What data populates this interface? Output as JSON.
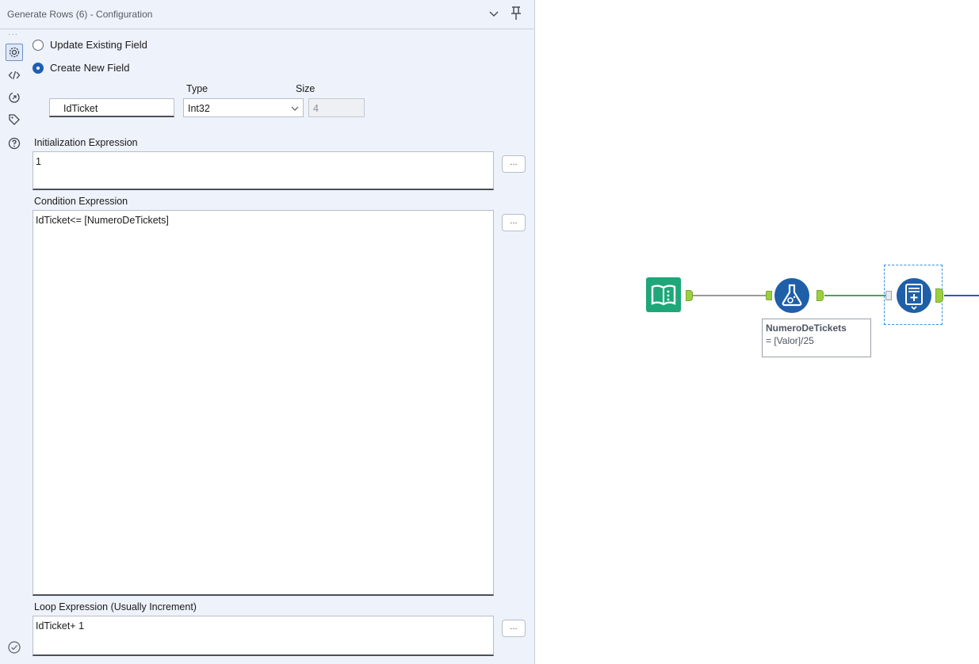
{
  "panel": {
    "title": "Generate Rows (6) - Configuration",
    "header_icons": [
      "chevron-down-icon",
      "pin-icon"
    ],
    "rail_icons": [
      "gear-icon",
      "code-icon",
      "annotation-icon",
      "tag-icon",
      "help-icon"
    ],
    "update_existing_label": "Update Existing Field",
    "create_new_label": "Create New  Field",
    "selected_mode": "create_new",
    "type_header": "Type",
    "size_header": "Size",
    "field_name": "IdTicket",
    "type_value": "Int32",
    "size_value": "4",
    "init_label": "Initialization Expression",
    "init_value": "1",
    "condition_label": "Condition Expression",
    "condition_value": "IdTicket<= [NumeroDeTickets]",
    "loop_label": "Loop Expression (Usually Increment)",
    "loop_value": "IdTicket+ 1",
    "ellipsis": "...",
    "footer_icon": "check-circle-icon"
  },
  "canvas": {
    "tools": [
      "input-data-tool-icon",
      "formula-tool-icon",
      "generate-rows-tool-icon"
    ],
    "annotation_line1": "NumeroDeTickets",
    "annotation_line2": "= [Valor]/25",
    "colors": {
      "input_tool": "#1fa77a",
      "formula_tool": "#1e5fa8",
      "generate_rows_tool": "#1e5fa8",
      "anchor": "#9ccf3f",
      "connection_gray": "#9a9a9a",
      "connection_green": "#4aa060",
      "connection_blue": "#3b4fd0",
      "selection": "#3a8fd8"
    }
  }
}
